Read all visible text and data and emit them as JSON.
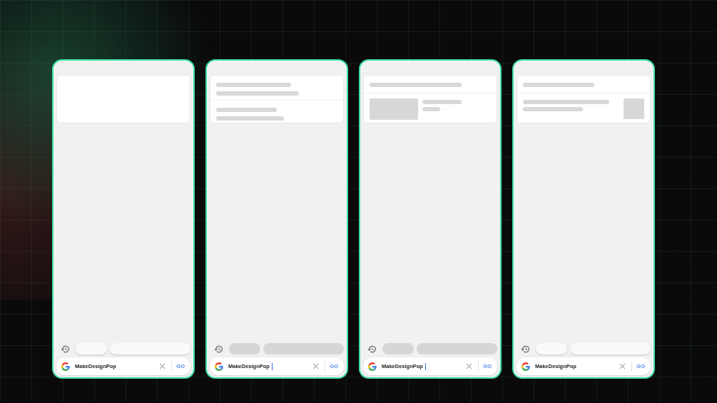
{
  "phones": [
    {
      "card": {
        "kind": "empty"
      },
      "chips_loading": false,
      "search": {
        "value": "MakeDesignPop",
        "focused": false,
        "button": "GO"
      }
    },
    {
      "card": {
        "kind": "text"
      },
      "chips_loading": true,
      "search": {
        "value": "MakeDesignPop",
        "focused": true,
        "button": "GO"
      }
    },
    {
      "card": {
        "kind": "image-left"
      },
      "chips_loading": true,
      "search": {
        "value": "MakeDesignPop",
        "focused": true,
        "button": "GO"
      }
    },
    {
      "card": {
        "kind": "image-right"
      },
      "chips_loading": false,
      "search": {
        "value": "MakeDesignPop",
        "focused": false,
        "button": "GO"
      }
    }
  ]
}
